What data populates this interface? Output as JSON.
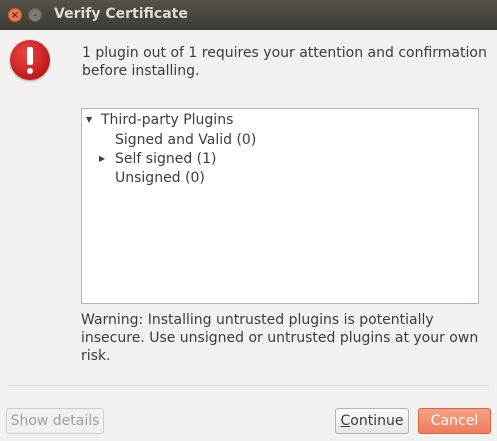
{
  "window": {
    "title": "Verify Certificate",
    "close_glyph": "×",
    "minimize_glyph": "–"
  },
  "icons": {
    "dialog_icon": "error-icon"
  },
  "message": "1 plugin out of 1 requires your attention and confirmation before installing.",
  "tree": {
    "root": {
      "label": "Third-party Plugins",
      "expanded": true
    },
    "children": [
      {
        "label": "Signed and Valid (0)",
        "expandable": false
      },
      {
        "label": "Self signed (1)",
        "expandable": true,
        "expanded": false
      },
      {
        "label": "Unsigned (0)",
        "expandable": false
      }
    ]
  },
  "warning": "Warning: Installing untrusted plugins is potentially insecure. Use unsigned or untrusted plugins at your own risk.",
  "buttons": {
    "show_details": "Show details",
    "continue_prefix": "C",
    "continue_rest": "ontinue",
    "cancel": "Cancel"
  },
  "colors": {
    "titlebar": "#3c3b37",
    "close_button": "#f07746",
    "cancel_button": "#ee7d5b",
    "error_icon": "#c21a1a"
  }
}
